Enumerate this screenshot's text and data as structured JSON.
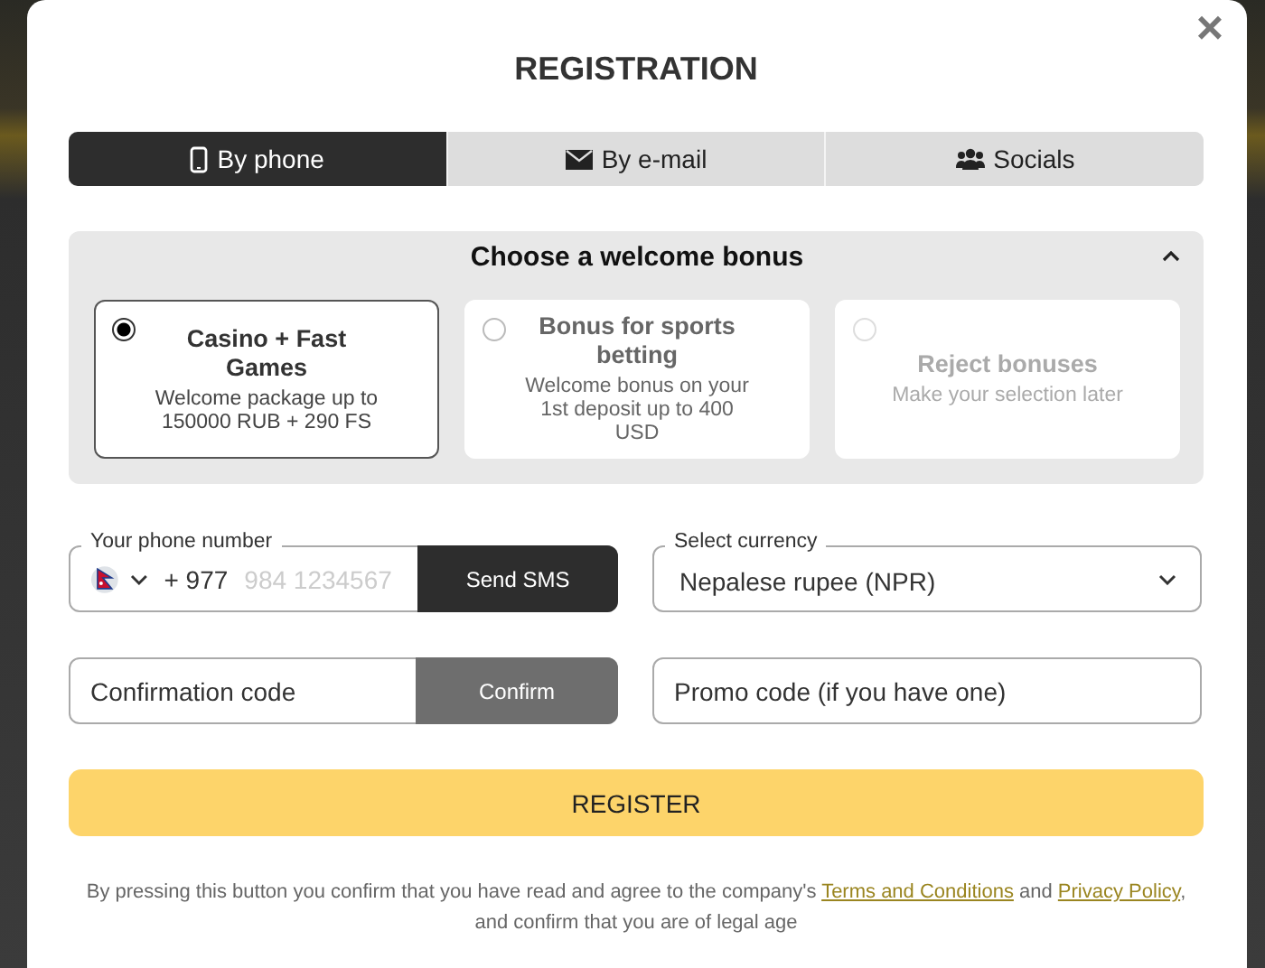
{
  "dialog": {
    "title": "REGISTRATION",
    "close": "×"
  },
  "tabs": [
    {
      "label": "By phone",
      "kind": "phone",
      "selected": true
    },
    {
      "label": "By e-mail",
      "kind": "email",
      "selected": false
    },
    {
      "label": "Socials",
      "kind": "socials",
      "selected": false
    }
  ],
  "bonus_panel": {
    "title": "Choose a welcome bonus",
    "expanded": true,
    "options": [
      {
        "title": "Casino + Fast Games",
        "description": "Welcome package up to 150000 RUB + 290 FS",
        "selected": true,
        "disabled": false
      },
      {
        "title": "Bonus for sports betting",
        "description": "Welcome bonus on your 1st deposit up to 400 USD",
        "selected": false,
        "disabled": false
      },
      {
        "title": "Reject bonuses",
        "description": "Make your selection later",
        "selected": false,
        "disabled": true
      }
    ]
  },
  "phone": {
    "label": "Your phone number",
    "code": "+ 977",
    "placeholder": "984 1234567",
    "button": "Send SMS"
  },
  "currency": {
    "label": "Select currency",
    "value": "Nepalese rupee (NPR)"
  },
  "confirmation": {
    "placeholder": "Confirmation code",
    "button": "Confirm"
  },
  "promo": {
    "placeholder": "Promo code (if you have one)"
  },
  "register_button": "REGISTER",
  "consent": [
    {
      "kind": "text",
      "text": "By pressing this button you confirm that you have read and agree to the company's "
    },
    {
      "kind": "link",
      "text": "Terms and Conditions"
    },
    {
      "kind": "text",
      "text": " and "
    },
    {
      "kind": "link",
      "text": "Privacy Policy"
    },
    {
      "kind": "text",
      "text": ", and confirm that you are of legal age"
    }
  ]
}
